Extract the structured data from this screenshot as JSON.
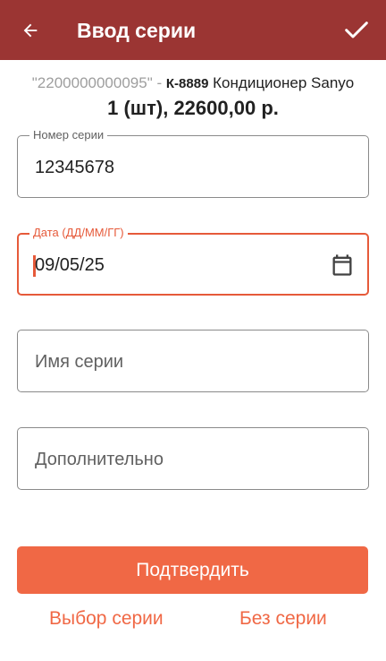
{
  "appbar": {
    "title": "Ввод серии",
    "back_icon": "arrow-back-icon",
    "confirm_icon": "checkmark-icon",
    "color": "#9b3533"
  },
  "product": {
    "barcode": "\"2200000000095\"",
    "separator": "-",
    "code": "К-8889",
    "name": "Кондиционер Sanyo",
    "quantity_price": "1 (шт), 22600,00 р."
  },
  "fields": {
    "serial_number": {
      "label": "Номер серии",
      "value": "12345678"
    },
    "date": {
      "label": "Дата (ДД/ММ/ГГ)",
      "value": "09/05/25",
      "icon": "calendar-icon"
    },
    "series_name": {
      "placeholder": "Имя серии"
    },
    "additional": {
      "placeholder": "Дополнительно"
    }
  },
  "actions": {
    "confirm_label": "Подтвердить",
    "choose_series_label": "Выбор серии",
    "no_series_label": "Без серии",
    "accent_color": "#f06845"
  }
}
